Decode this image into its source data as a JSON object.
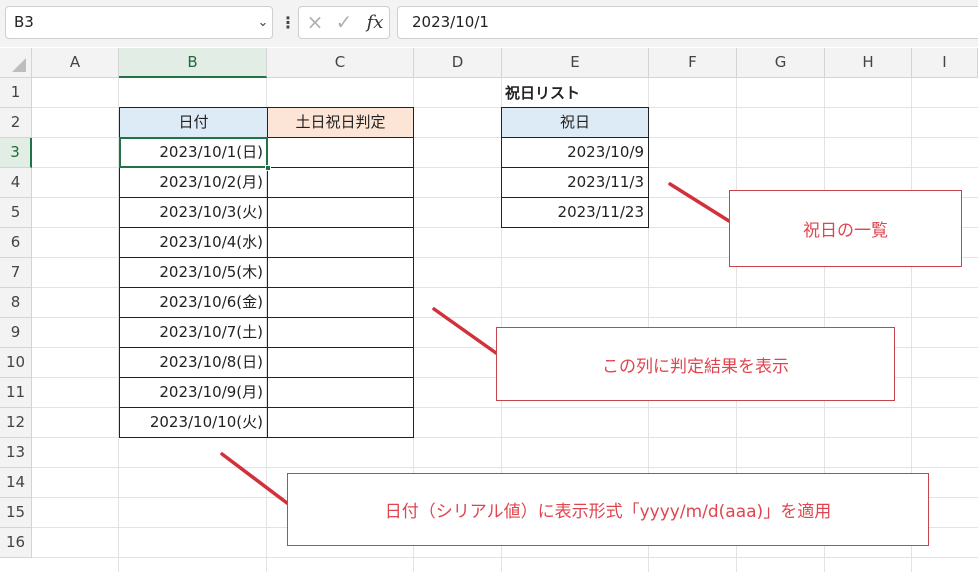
{
  "formula_bar": {
    "name_box": "B3",
    "cancel_icon": "×",
    "enter_icon": "✓",
    "fx_label": "fx",
    "formula": "2023/10/1"
  },
  "columns": [
    "A",
    "B",
    "C",
    "D",
    "E",
    "F",
    "G",
    "H",
    "I"
  ],
  "rows": [
    "1",
    "2",
    "3",
    "4",
    "5",
    "6",
    "7",
    "8",
    "9",
    "10",
    "11",
    "12",
    "13",
    "14",
    "15",
    "16"
  ],
  "selected_cell": "B3",
  "table1": {
    "header_date": "日付",
    "header_judge": "土日祝日判定",
    "dates": [
      "2023/10/1(日)",
      "2023/10/2(月)",
      "2023/10/3(火)",
      "2023/10/4(水)",
      "2023/10/5(木)",
      "2023/10/6(金)",
      "2023/10/7(土)",
      "2023/10/8(日)",
      "2023/10/9(月)",
      "2023/10/10(火)"
    ]
  },
  "holiday_list": {
    "title": "祝日リスト",
    "header": "祝日",
    "dates": [
      "2023/10/9",
      "2023/11/3",
      "2023/11/23"
    ]
  },
  "callouts": {
    "holidays": "祝日の一覧",
    "result_column": "この列に判定結果を表示",
    "format_note": "日付（シリアル値）に表示形式「yyyy/m/d(aaa)」を適用"
  },
  "colors": {
    "header_blue": "#ddebf7",
    "header_orange": "#fce4d6",
    "selection_green": "#217346",
    "callout_red": "#e0454f"
  }
}
